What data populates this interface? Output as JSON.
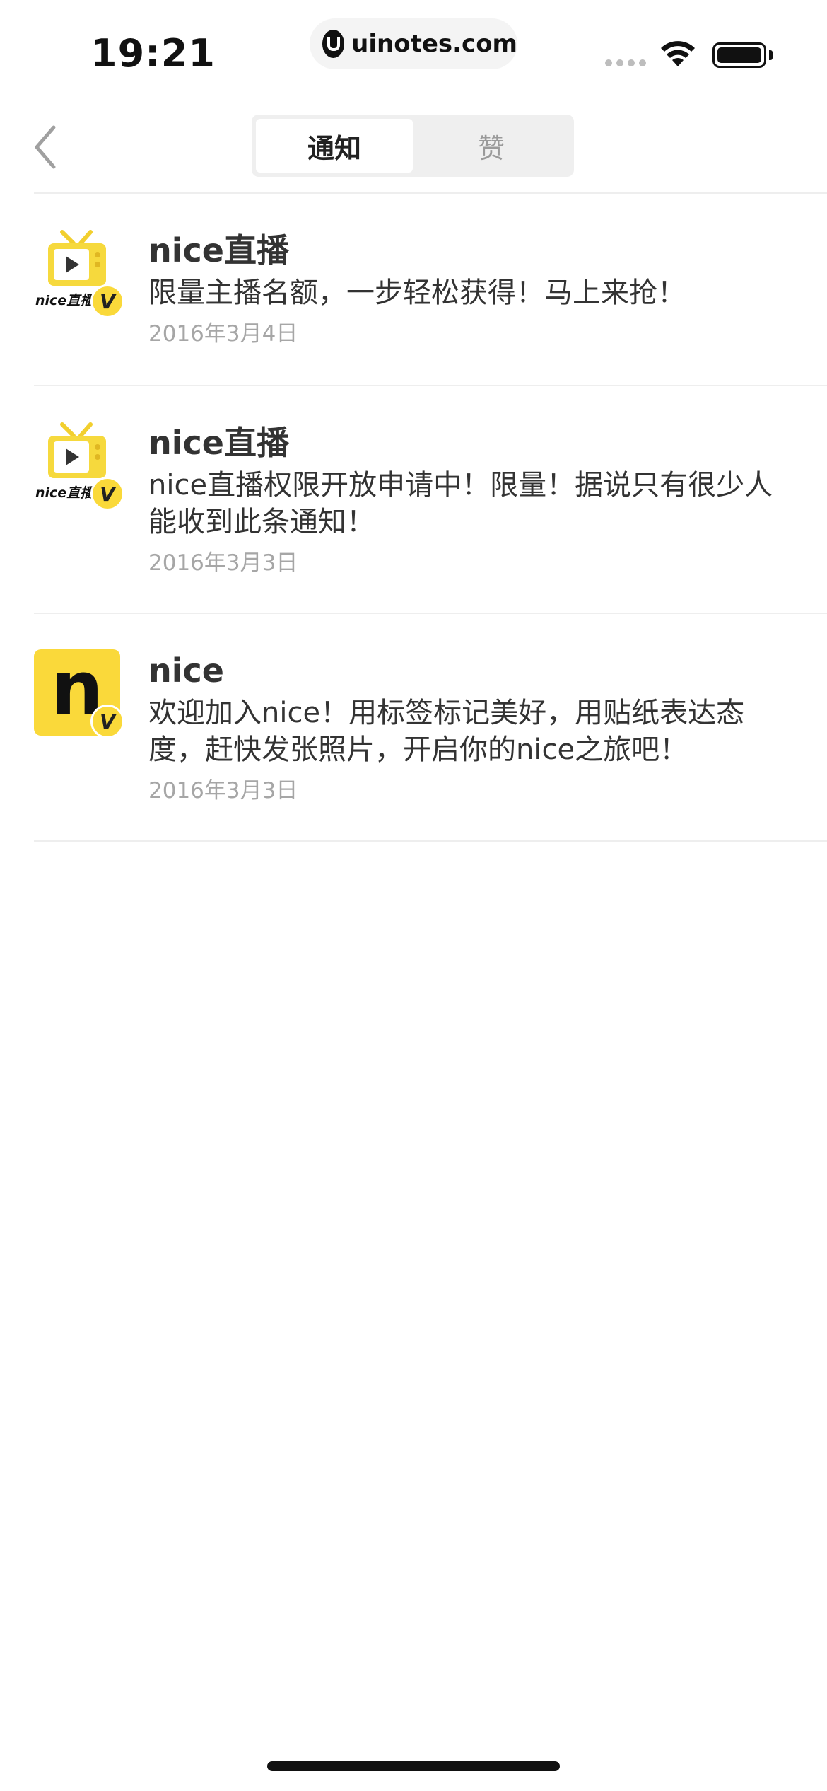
{
  "status_bar": {
    "time": "19:21",
    "url": "uinotes.com",
    "icons": [
      "signal-dots-icon",
      "wifi-icon",
      "battery-icon"
    ]
  },
  "nav": {
    "back_icon": "chevron-left-icon",
    "tabs": [
      {
        "label": "通知",
        "active": true
      },
      {
        "label": "赞",
        "active": false
      }
    ]
  },
  "notifications": [
    {
      "avatar": "nice-live-tv-icon",
      "avatar_text": "nice直播",
      "badge": "V",
      "title": "nice直播",
      "text": "限量主播名额，一步轻松获得！马上来抢！",
      "date": "2016年3月4日"
    },
    {
      "avatar": "nice-live-tv-icon",
      "avatar_text": "nice直播",
      "badge": "V",
      "title": "nice直播",
      "text": "nice直播权限开放申请中！限量！据说只有很少人能收到此条通知！",
      "date": "2016年3月3日"
    },
    {
      "avatar": "nice-logo-icon",
      "avatar_text": "n",
      "badge": "V",
      "title": "nice",
      "text": "欢迎加入nice！用标签标记美好，用贴纸表达态度，赶快发张照片，开启你的nice之旅吧！",
      "date": "2016年3月3日"
    }
  ],
  "colors": {
    "brand_yellow": "#fad93a",
    "divider": "#eeeeee",
    "muted_text": "#a6a6a6"
  }
}
